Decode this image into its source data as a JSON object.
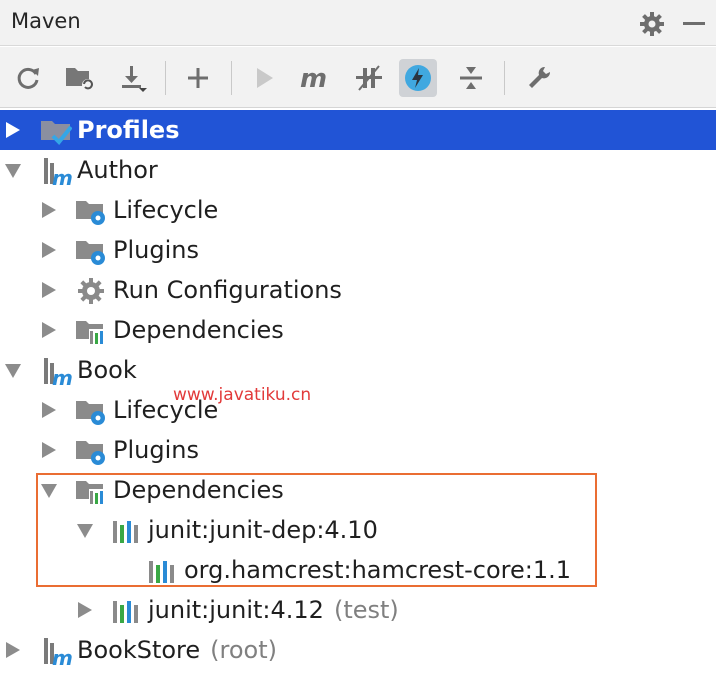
{
  "panel": {
    "title": "Maven"
  },
  "tree": {
    "profiles": "Profiles",
    "author": {
      "name": "Author",
      "lifecycle": "Lifecycle",
      "plugins": "Plugins",
      "run_configurations": "Run Configurations",
      "dependencies": "Dependencies"
    },
    "book": {
      "name": "Book",
      "lifecycle": "Lifecycle",
      "plugins": "Plugins",
      "dependencies": "Dependencies",
      "deps": [
        {
          "label": "junit:junit-dep:4.10",
          "children": [
            {
              "label": "org.hamcrest:hamcrest-core:1.1"
            }
          ]
        },
        {
          "label": "junit:junit:4.12",
          "scope": "(test)"
        }
      ]
    },
    "bookstore": {
      "name": "BookStore",
      "suffix": "(root)"
    }
  },
  "watermark": "www.javatiku.cn",
  "colors": {
    "selection": "#2154d6",
    "highlight_border": "#ea6d33",
    "maven_m": "#2a8bd6",
    "watermark": "#e23a3a"
  }
}
